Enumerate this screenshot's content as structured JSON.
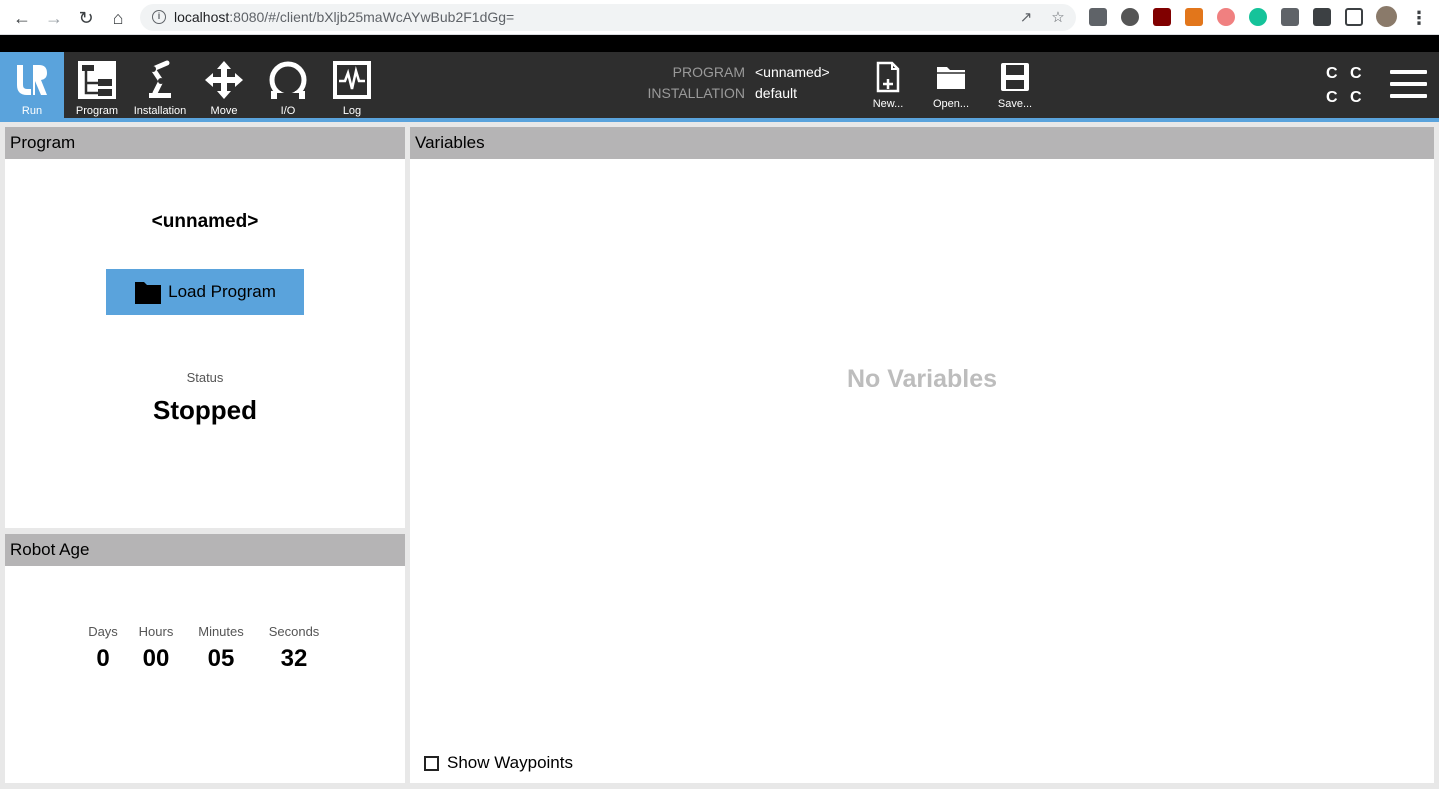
{
  "browser": {
    "url_host": "localhost",
    "url_path": ":8080/#/client/bXljb25maWcAYwBub2F1dGg="
  },
  "tabs": [
    {
      "label": "Run",
      "icon": "ur-logo-icon"
    },
    {
      "label": "Program",
      "icon": "program-tree-icon"
    },
    {
      "label": "Installation",
      "icon": "robot-arm-icon"
    },
    {
      "label": "Move",
      "icon": "move-arrows-icon"
    },
    {
      "label": "I/O",
      "icon": "io-icon"
    },
    {
      "label": "Log",
      "icon": "log-icon"
    }
  ],
  "header": {
    "program_key": "PROGRAM",
    "program_value": "<unnamed>",
    "installation_key": "INSTALLATION",
    "installation_value": "default",
    "new_label": "New...",
    "open_label": "Open...",
    "save_label": "Save...",
    "cc_top_left": "C",
    "cc_top_right": "C",
    "cc_bottom_left": "C",
    "cc_bottom_right": "C"
  },
  "program_panel": {
    "title": "Program",
    "program_name": "<unnamed>",
    "load_button": "Load Program",
    "status_label": "Status",
    "status_value": "Stopped"
  },
  "robot_age": {
    "title": "Robot Age",
    "days_label": "Days",
    "days": "0",
    "hours_label": "Hours",
    "hours": "00",
    "minutes_label": "Minutes",
    "minutes": "05",
    "seconds_label": "Seconds",
    "seconds": "32"
  },
  "variables_panel": {
    "title": "Variables",
    "empty_text": "No Variables",
    "show_waypoints": "Show Waypoints"
  },
  "colors": {
    "accent": "#5aa3dc",
    "header_bg": "#2e2e2e",
    "panel_head": "#b5b4b5"
  }
}
